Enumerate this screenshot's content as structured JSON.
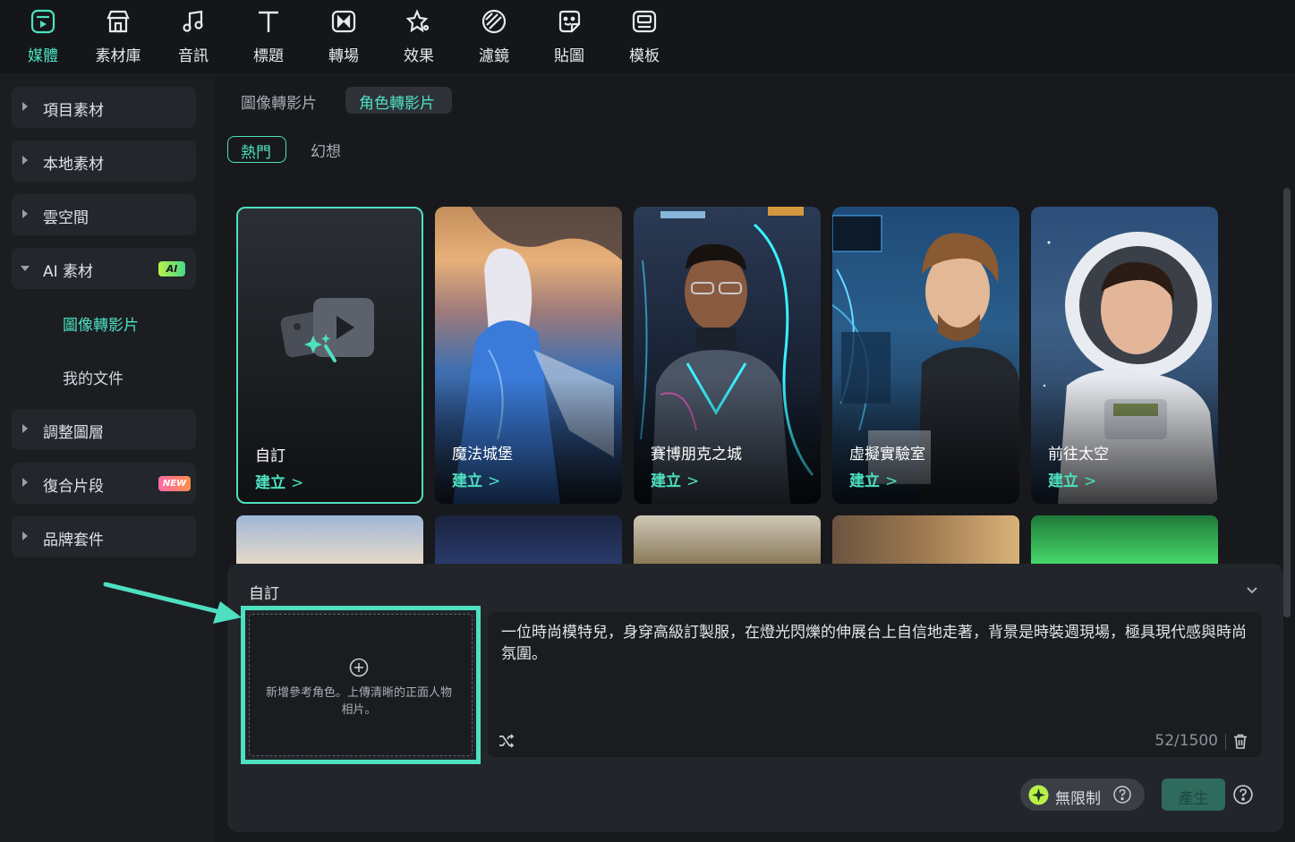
{
  "toolbar": {
    "items": [
      {
        "label": "媒體",
        "icon": "media-icon",
        "active": true
      },
      {
        "label": "素材庫",
        "icon": "store-icon"
      },
      {
        "label": "音訊",
        "icon": "music-note-icon"
      },
      {
        "label": "標題",
        "icon": "text-t-icon"
      },
      {
        "label": "轉場",
        "icon": "transition-icon"
      },
      {
        "label": "效果",
        "icon": "effects-star-icon"
      },
      {
        "label": "濾鏡",
        "icon": "filter-icon"
      },
      {
        "label": "貼圖",
        "icon": "sticker-icon"
      },
      {
        "label": "模板",
        "icon": "template-icon"
      }
    ]
  },
  "sidebar": {
    "items": [
      {
        "label": "項目素材"
      },
      {
        "label": "本地素材"
      },
      {
        "label": "雲空間"
      },
      {
        "label": "AI 素材",
        "badge": "AI",
        "expanded": true
      },
      {
        "label": "調整圖層"
      },
      {
        "label": "復合片段",
        "badge": "NEW"
      },
      {
        "label": "品牌套件"
      }
    ],
    "sub_items": [
      {
        "label": "圖像轉影片",
        "active": true
      },
      {
        "label": "我的文件"
      }
    ]
  },
  "main": {
    "tabs": [
      {
        "label": "圖像轉影片"
      },
      {
        "label": "角色轉影片",
        "active": true
      }
    ],
    "filters": [
      {
        "label": "熱門",
        "active": true
      },
      {
        "label": "幻想"
      }
    ],
    "cards": [
      {
        "title": "自訂",
        "action": "建立"
      },
      {
        "title": "魔法城堡",
        "action": "建立"
      },
      {
        "title": "賽博朋克之城",
        "action": "建立"
      },
      {
        "title": "虛擬實驗室",
        "action": "建立"
      },
      {
        "title": "前往太空",
        "action": "建立"
      }
    ],
    "chevron": ">"
  },
  "panel": {
    "title": "自訂",
    "upload_hint": "新增參考角色。上傳清晰的正面人物相片。",
    "prompt_text": "一位時尚模特兒，身穿高級訂製服，在燈光閃爍的伸展台上自信地走著，背景是時裝週現場，極具現代感與時尚氛圍。",
    "counter": "52/1500",
    "unlimited_label": "無限制",
    "generate_label": "產生"
  },
  "colors": {
    "accent": "#4ee0c0",
    "background": "#17191c",
    "panel": "#22252a"
  }
}
